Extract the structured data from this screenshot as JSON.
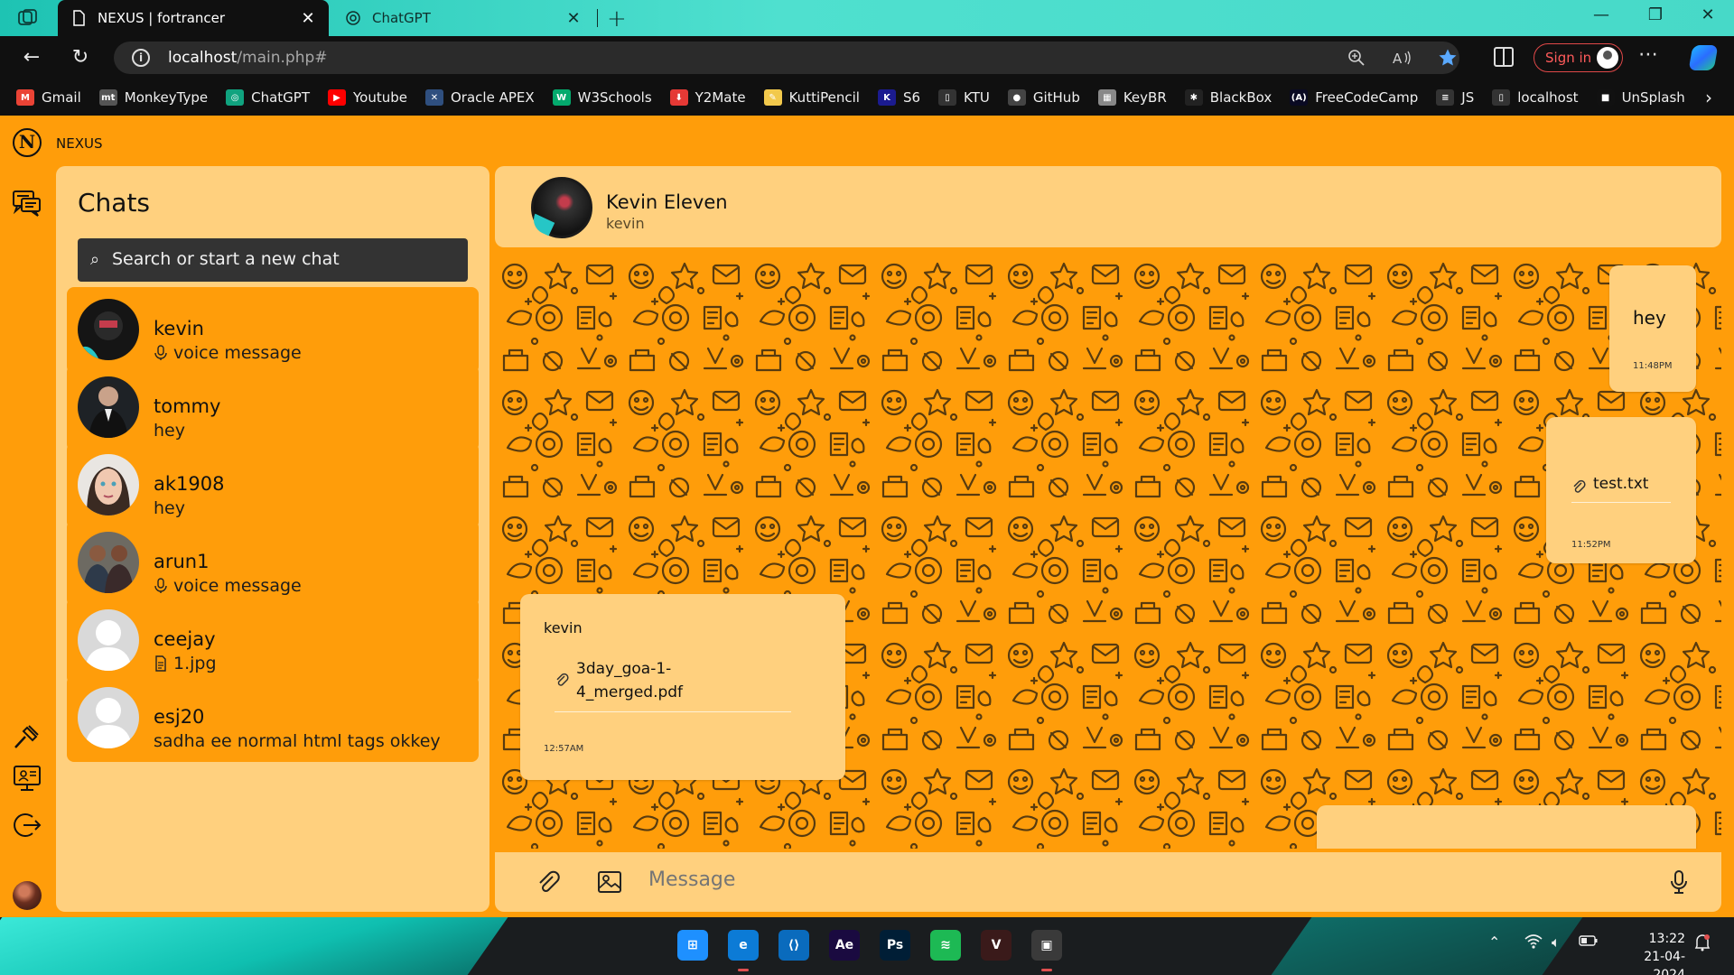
{
  "browser": {
    "tabs": [
      {
        "title": "NEXUS | fortrancer",
        "close": "✕"
      },
      {
        "title": "ChatGPT",
        "close": "✕"
      }
    ],
    "new_tab": "+",
    "window_controls": {
      "minimize": "—",
      "maximize": "❐",
      "close": "✕"
    },
    "nav": {
      "back": "←",
      "reload": "↻"
    },
    "url_host": "localhost",
    "url_path": "/main.php#",
    "sign_in": "Sign in",
    "more": "⋯",
    "bookmarks": [
      {
        "label": "Gmail",
        "icon": "gmail-icon",
        "color": "#ea4335",
        "glyph": "M"
      },
      {
        "label": "MonkeyType",
        "icon": "monkeytype-icon",
        "color": "#555555",
        "glyph": "mt"
      },
      {
        "label": "ChatGPT",
        "icon": "chatgpt-icon",
        "color": "#10a37f",
        "glyph": "◎"
      },
      {
        "label": "Youtube",
        "icon": "youtube-icon",
        "color": "#ff0000",
        "glyph": "▶"
      },
      {
        "label": "Oracle APEX",
        "icon": "apex-icon",
        "color": "#2f4f7f",
        "glyph": "✕"
      },
      {
        "label": "W3Schools",
        "icon": "w3schools-icon",
        "color": "#04aa6d",
        "glyph": "W"
      },
      {
        "label": "Y2Mate",
        "icon": "y2mate-icon",
        "color": "#e53935",
        "glyph": "⬇"
      },
      {
        "label": "KuttiPencil",
        "icon": "pencil-icon",
        "color": "#f2c94c",
        "glyph": "✎"
      },
      {
        "label": "S6",
        "icon": "k-icon",
        "color": "#1b1b8f",
        "glyph": "K"
      },
      {
        "label": "KTU",
        "icon": "page-icon",
        "color": "#333333",
        "glyph": "▯"
      },
      {
        "label": "GitHub",
        "icon": "github-icon",
        "color": "#444444",
        "glyph": "●"
      },
      {
        "label": "KeyBR",
        "icon": "keybr-icon",
        "color": "#888888",
        "glyph": "▦"
      },
      {
        "label": "BlackBox",
        "icon": "blackbox-icon",
        "color": "#222222",
        "glyph": "✱"
      },
      {
        "label": "FreeCodeCamp",
        "icon": "fcc-icon",
        "color": "#0a0a23",
        "glyph": "(A)"
      },
      {
        "label": "JS",
        "icon": "js-icon",
        "color": "#333333",
        "glyph": "≡"
      },
      {
        "label": "localhost",
        "icon": "page-icon",
        "color": "#333333",
        "glyph": "▯"
      },
      {
        "label": "UnSplash",
        "icon": "unsplash-icon",
        "color": "#111111",
        "glyph": "■"
      }
    ],
    "bookmarks_more": "›"
  },
  "app": {
    "brand": "NEXUS",
    "brand_letter": "N",
    "chats_title": "Chats",
    "search_placeholder": "Search or start a new chat",
    "conversations": [
      {
        "name": "kevin",
        "last": "voice message",
        "last_icon": "mic-icon",
        "avatar": "dark"
      },
      {
        "name": "tommy",
        "last": "hey",
        "last_icon": "",
        "avatar": "suit"
      },
      {
        "name": "ak1908",
        "last": "hey",
        "last_icon": "",
        "avatar": "face"
      },
      {
        "name": "arun1",
        "last": "voice message",
        "last_icon": "mic-icon",
        "avatar": "group"
      },
      {
        "name": "ceejay",
        "last": "1.jpg",
        "last_icon": "file-icon",
        "avatar": "default"
      },
      {
        "name": "esj20",
        "last": "sadha ee normal html tags okkey",
        "last_icon": "",
        "avatar": "default"
      }
    ],
    "header": {
      "name": "Kevin Eleven",
      "username": "kevin"
    },
    "messages": [
      {
        "type": "sent",
        "text": "hey",
        "time": "11:48PM"
      },
      {
        "type": "sent-file",
        "file": "test.txt",
        "time": "11:52PM"
      },
      {
        "type": "received-file",
        "sender": "kevin",
        "file_line1": "3day_goa-1-",
        "file_line2": "4_merged.pdf",
        "time": "12:57AM"
      }
    ],
    "composer_placeholder": "Message"
  },
  "taskbar": {
    "apps": [
      {
        "name": "windows-start",
        "glyph": "⊞",
        "color": "#1e90ff"
      },
      {
        "name": "edge",
        "glyph": "e",
        "color": "#0c7bd6"
      },
      {
        "name": "vscode",
        "glyph": "⟨⟩",
        "color": "#0a6bbd"
      },
      {
        "name": "after-effects",
        "glyph": "Ae",
        "color": "#1a0a40"
      },
      {
        "name": "photoshop",
        "glyph": "Ps",
        "color": "#001e36"
      },
      {
        "name": "spotify",
        "glyph": "≋",
        "color": "#1db954"
      },
      {
        "name": "vivaldi",
        "glyph": "V",
        "color": "#3a1a1a"
      },
      {
        "name": "app-window",
        "glyph": "▣",
        "color": "#3a3a3a"
      }
    ],
    "time": "13:22",
    "date": "21-04-2024"
  }
}
